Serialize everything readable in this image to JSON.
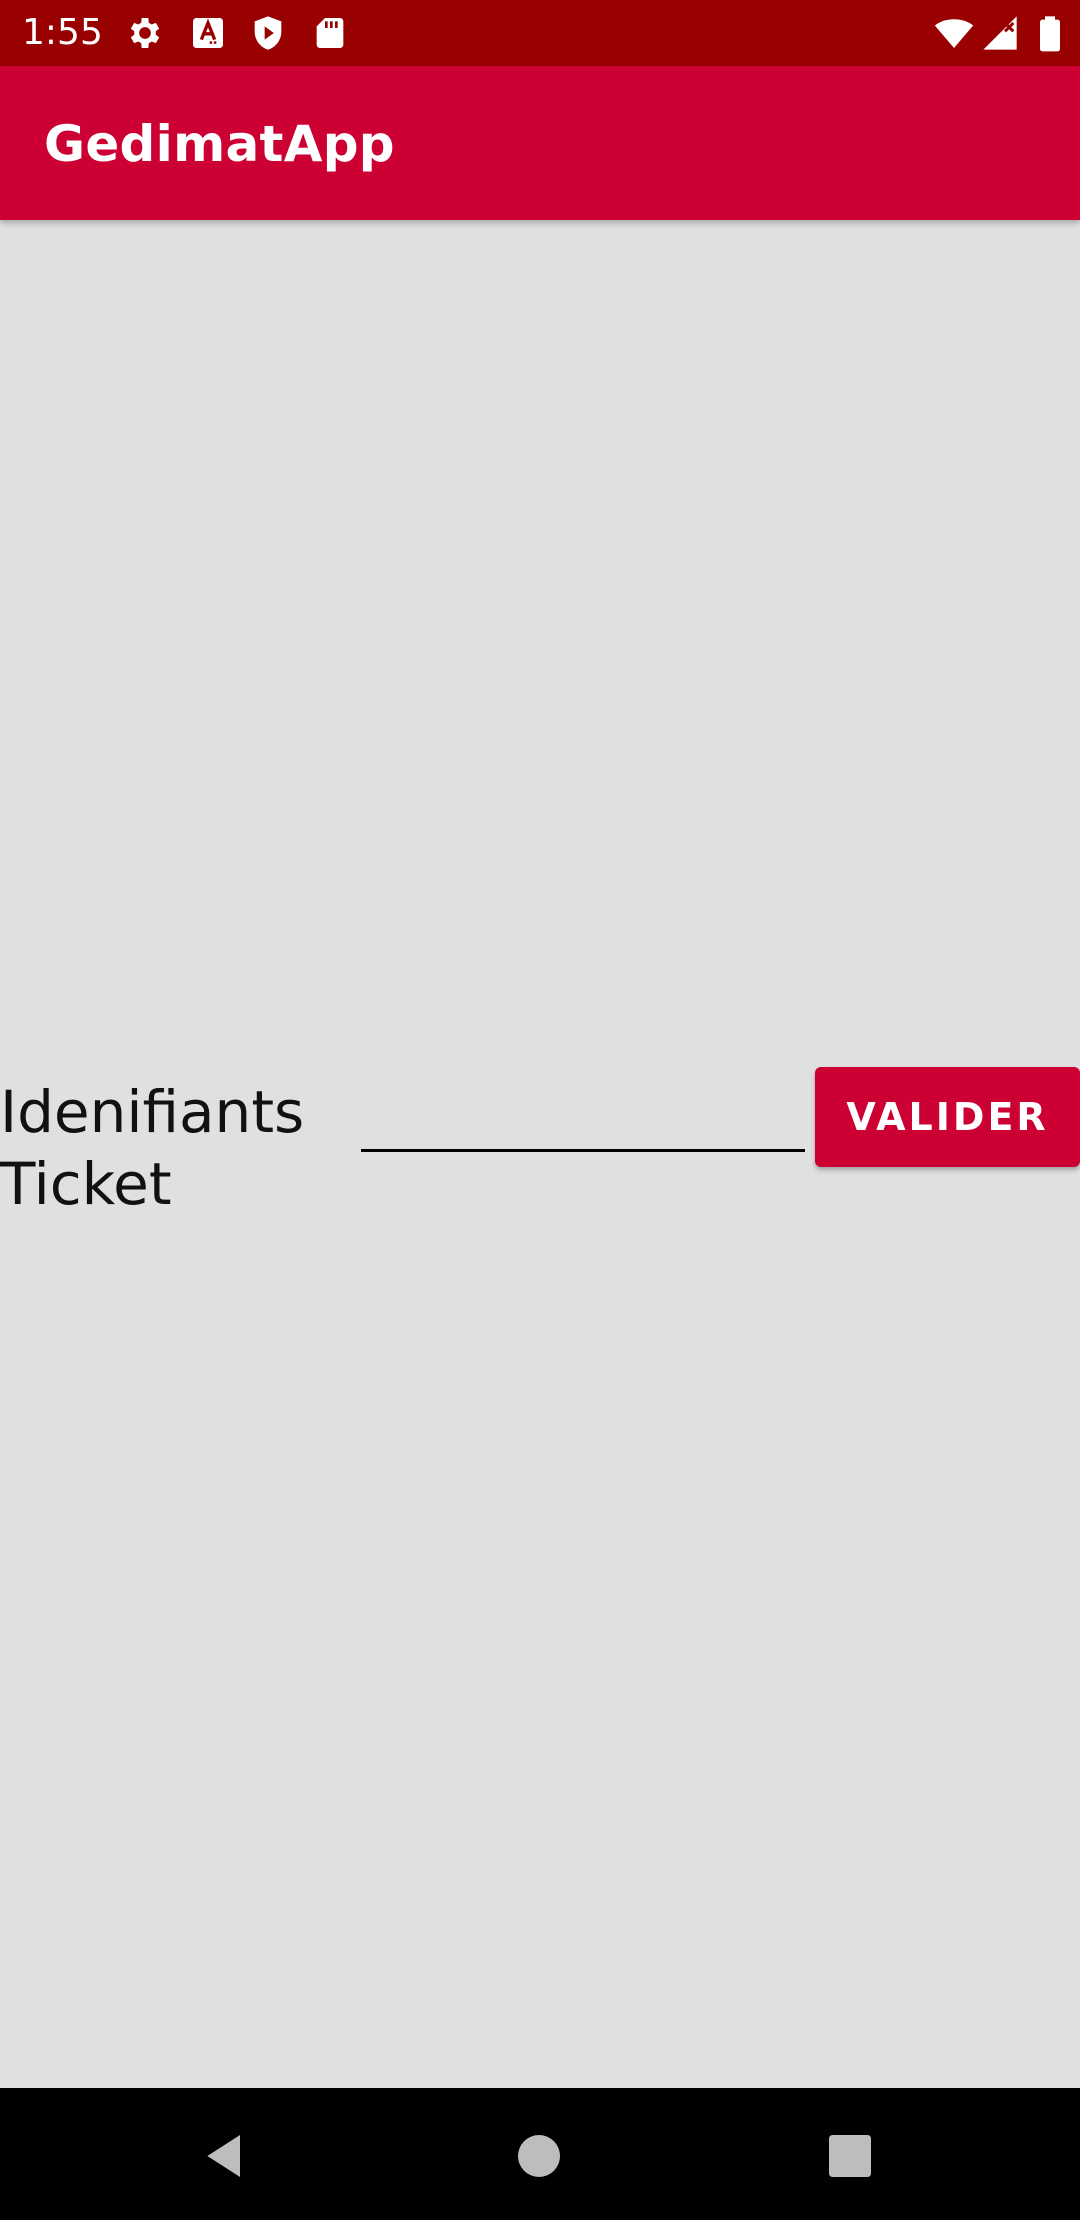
{
  "status_bar": {
    "time": "1:55",
    "left_icons": [
      "gear-icon",
      "a-notification-icon",
      "play-protect-icon",
      "sd-card-icon"
    ],
    "right_icons": [
      "wifi-icon",
      "cellular-signal-icon",
      "battery-icon"
    ]
  },
  "app_bar": {
    "title": "GedimatApp"
  },
  "form": {
    "label": "Idenifiants Ticket",
    "input_value": "",
    "input_placeholder": "",
    "submit_label": "VALIDER"
  },
  "nav_bar": {
    "icons": [
      "back-icon",
      "home-icon",
      "recents-icon"
    ]
  },
  "colors": {
    "status_bar": "#990000",
    "primary": "#cc0033",
    "background": "#e0e0e0",
    "nav_bar": "#000000"
  }
}
